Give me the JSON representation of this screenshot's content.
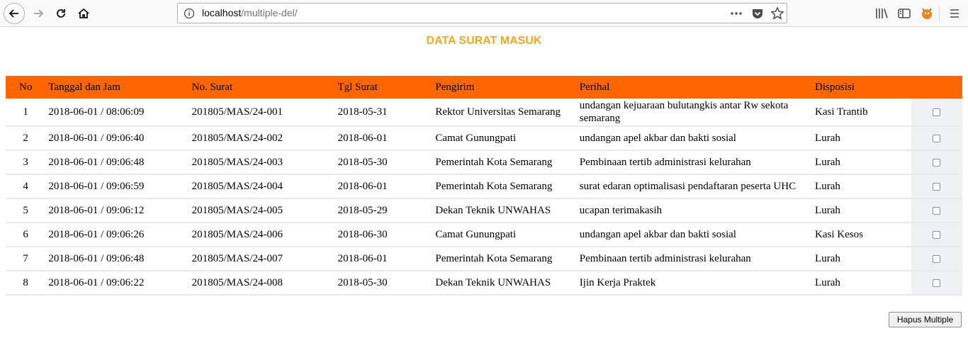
{
  "browser": {
    "url_host": "localhost",
    "url_path": "/multiple-del/"
  },
  "page": {
    "title": "DATA SURAT MASUK",
    "delete_button": "Hapus Multiple"
  },
  "table": {
    "headers": {
      "no": "No",
      "tanggal": "Tanggal dan Jam",
      "nosurat": "No. Surat",
      "tglsurat": "Tgl Surat",
      "pengirim": "Pengirim",
      "perihal": "Perihal",
      "disposisi": "Disposisi"
    },
    "rows": [
      {
        "no": "1",
        "tanggal": "2018-06-01 / 08:06:09",
        "nosurat": "201805/MAS/24-001",
        "tglsurat": "2018-05-31",
        "pengirim": "Rektor Universitas Semarang",
        "perihal": "undangan kejuaraan bulutangkis antar Rw sekota semarang",
        "disposisi": "Kasi Trantib"
      },
      {
        "no": "2",
        "tanggal": "2018-06-01 / 09:06:40",
        "nosurat": "201805/MAS/24-002",
        "tglsurat": "2018-06-01",
        "pengirim": "Camat Gunungpati",
        "perihal": "undangan apel akbar dan bakti sosial",
        "disposisi": "Lurah"
      },
      {
        "no": "3",
        "tanggal": "2018-06-01 / 09:06:48",
        "nosurat": "201805/MAS/24-003",
        "tglsurat": "2018-05-30",
        "pengirim": "Pemerintah Kota Semarang",
        "perihal": "Pembinaan tertib administrasi kelurahan",
        "disposisi": "Lurah"
      },
      {
        "no": "4",
        "tanggal": "2018-06-01 / 09:06:59",
        "nosurat": "201805/MAS/24-004",
        "tglsurat": "2018-06-01",
        "pengirim": "Pemerintah Kota Semarang",
        "perihal": "surat edaran optimalisasi pendaftaran peserta UHC",
        "disposisi": "Lurah"
      },
      {
        "no": "5",
        "tanggal": "2018-06-01 / 09:06:12",
        "nosurat": "201805/MAS/24-005",
        "tglsurat": "2018-05-29",
        "pengirim": "Dekan Teknik UNWAHAS",
        "perihal": "ucapan terimakasih",
        "disposisi": "Lurah"
      },
      {
        "no": "6",
        "tanggal": "2018-06-01 / 09:06:26",
        "nosurat": "201805/MAS/24-006",
        "tglsurat": "2018-06-30",
        "pengirim": "Camat Gunungpati",
        "perihal": "undangan apel akbar dan bakti sosial",
        "disposisi": "Kasi Kesos"
      },
      {
        "no": "7",
        "tanggal": "2018-06-01 / 09:06:48",
        "nosurat": "201805/MAS/24-007",
        "tglsurat": "2018-06-01",
        "pengirim": "Pemerintah Kota Semarang",
        "perihal": "Pembinaan tertib administrasi kelurahan",
        "disposisi": "Lurah"
      },
      {
        "no": "8",
        "tanggal": "2018-06-01 / 09:06:22",
        "nosurat": "201805/MAS/24-008",
        "tglsurat": "2018-05-30",
        "pengirim": "Dekan Teknik UNWAHAS",
        "perihal": "Ijin Kerja Praktek",
        "disposisi": "Lurah"
      }
    ]
  },
  "colors": {
    "header_bg": "#ff6600",
    "title": "#f5a623"
  }
}
